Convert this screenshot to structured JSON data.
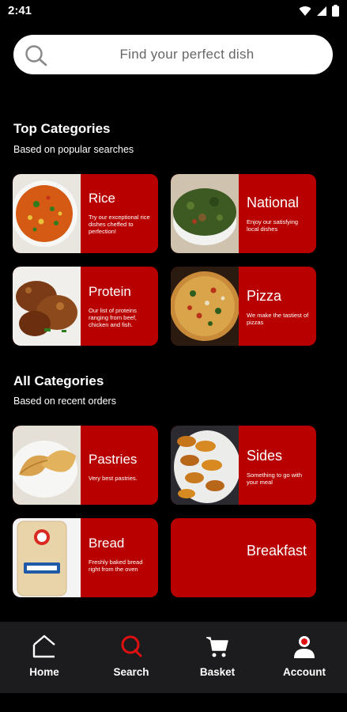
{
  "status_bar": {
    "time": "2:41"
  },
  "search": {
    "placeholder": "Find your perfect dish"
  },
  "top_categories": {
    "title": "Top Categories",
    "subtitle": "Based on popular searches",
    "items": [
      {
        "title": "Rice",
        "description": "Try our exceptional rice dishes cheffed to perfection!",
        "image": "rice-dish"
      },
      {
        "title": "National",
        "description": "Enjoy our satisfying local dishes",
        "image": "vegetable-soup"
      },
      {
        "title": "Protein",
        "description": "Our list of proteins ranging from beef, chicken and fish.",
        "image": "chicken"
      },
      {
        "title": "Pizza",
        "description": "We make the tastiest of pizzas",
        "image": "pizza"
      }
    ]
  },
  "all_categories": {
    "title": "All Categories",
    "subtitle": "Based on recent orders",
    "items": [
      {
        "title": "Pastries",
        "description": "Very best pastries.",
        "image": "meat-pies"
      },
      {
        "title": "Sides",
        "description": "Something to go with your meal",
        "image": "fried-plantain"
      },
      {
        "title": "Bread",
        "description": "Freshly baked bread right from the oven",
        "image": "bread-loaf"
      },
      {
        "title": "Breakfast",
        "description": "",
        "image": ""
      }
    ]
  },
  "bottom_nav": [
    {
      "label": "Home",
      "icon": "home-icon",
      "active": false
    },
    {
      "label": "Search",
      "icon": "search-icon",
      "active": true
    },
    {
      "label": "Basket",
      "icon": "cart-icon",
      "active": false
    },
    {
      "label": "Account",
      "icon": "account-icon",
      "active": false
    }
  ],
  "colors": {
    "card": "#b80000",
    "accent": "#e01010",
    "background": "#000000",
    "nav": "#1c1c1e"
  }
}
